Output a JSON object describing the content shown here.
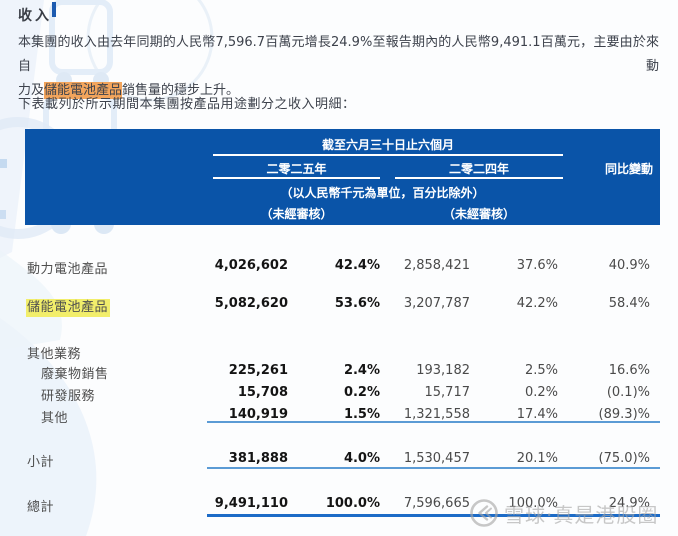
{
  "document": {
    "title": "收入",
    "paragraph": {
      "line1": "本集團的收入由去年同期的人民幣7,596.7百萬元增長24.9%至報告期內的人民幣9,491.1百萬元，主要由於來自動",
      "line2_pre": "力及",
      "line2_highlight": "儲能電池產品",
      "line2_post": "銷售量的穩步上升。"
    },
    "table_intro": "下表載列於所示期間本集團按產品用途劃分之收入明細："
  },
  "table": {
    "header": {
      "period": "截至六月三十日止六個月",
      "col_2025": "二零二五年",
      "col_2024": "二零二四年",
      "col_yoy": "同比變動",
      "unit_note": "（以人民幣千元為單位，百分比除外）",
      "unaudited_2025": "（未經審核）",
      "unaudited_2024": "（未經審核）"
    },
    "rows": [
      {
        "label": "動力電池產品",
        "v2025": "4,026,602",
        "p2025": "42.4%",
        "v2024": "2,858,421",
        "p2024": "37.6%",
        "yoy": "40.9%"
      },
      {
        "label": "儲能電池產品",
        "v2025": "5,082,620",
        "p2025": "53.6%",
        "v2024": "3,207,787",
        "p2024": "42.2%",
        "yoy": "58.4%"
      },
      {
        "label": "其他業務"
      },
      {
        "label": "廢棄物銷售",
        "v2025": "225,261",
        "p2025": "2.4%",
        "v2024": "193,182",
        "p2024": "2.5%",
        "yoy": "16.6%"
      },
      {
        "label": "研發服務",
        "v2025": "15,708",
        "p2025": "0.2%",
        "v2024": "15,717",
        "p2024": "0.2%",
        "yoy": "(0.1)%"
      },
      {
        "label": "其他",
        "v2025": "140,919",
        "p2025": "1.5%",
        "v2024": "1,321,558",
        "p2024": "17.4%",
        "yoy": "(89.3)%"
      },
      {
        "label": "小計",
        "v2025": "381,888",
        "p2025": "4.0%",
        "v2024": "1,530,457",
        "p2024": "20.1%",
        "yoy": "(75.0)%"
      },
      {
        "label": "總計",
        "v2025": "9,491,110",
        "p2025": "100.0%",
        "v2024": "7,596,665",
        "p2024": "100.0%",
        "yoy": "24.9%"
      }
    ]
  },
  "watermark": {
    "text": "雪球·真是港股圈"
  },
  "colors": {
    "header_bg": "#0a54a8",
    "rule_light": "#5b9bd5",
    "rule_total": "#1c6bc7",
    "highlight_orange": "#f3a55c",
    "highlight_yellow": "#f2ee6b",
    "watermark_gray": "#a7a7a7"
  }
}
